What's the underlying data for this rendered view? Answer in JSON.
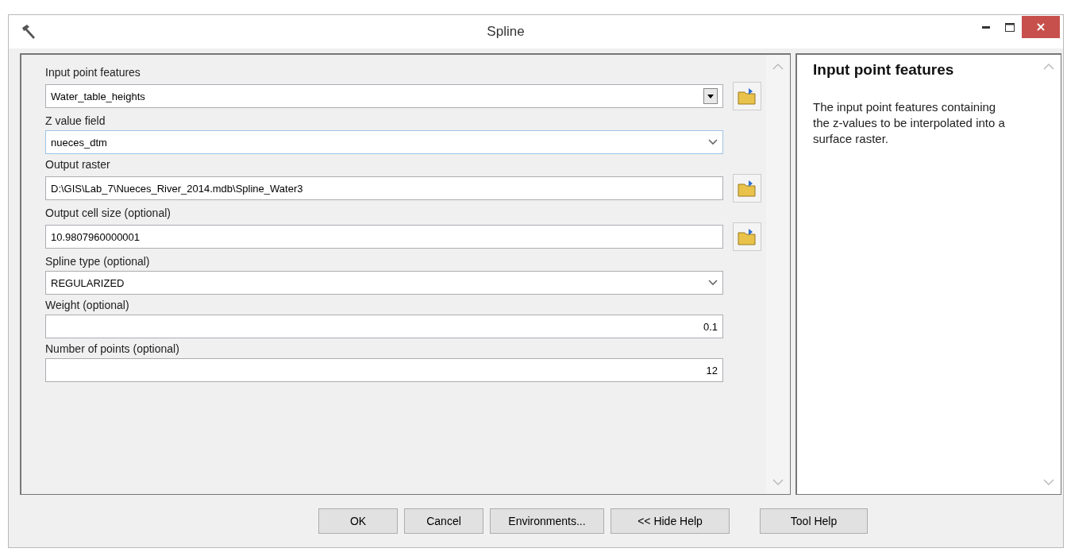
{
  "window": {
    "title": "Spline"
  },
  "fields": [
    {
      "label": "Input point features",
      "value": "Water_table_heights",
      "kind": "combo"
    },
    {
      "label": "Z value field",
      "value": "nueces_dtm",
      "kind": "select"
    },
    {
      "label": "Output raster",
      "value": "D:\\GIS\\Lab_7\\Nueces_River_2014.mdb\\Spline_Water3",
      "kind": "path"
    },
    {
      "label": "Output cell size (optional)",
      "value": "10.9807960000001",
      "kind": "path"
    },
    {
      "label": "Spline type (optional)",
      "value": "REGULARIZED",
      "kind": "select"
    },
    {
      "label": "Weight (optional)",
      "value": "0.1",
      "kind": "number"
    },
    {
      "label": "Number of points (optional)",
      "value": "12",
      "kind": "number"
    }
  ],
  "help": {
    "title": "Input point features",
    "text": "The input point features containing the z-values to be interpolated into a surface raster."
  },
  "buttons": [
    "OK",
    "Cancel",
    "Environments...",
    "<< Hide Help",
    "Tool Help"
  ]
}
